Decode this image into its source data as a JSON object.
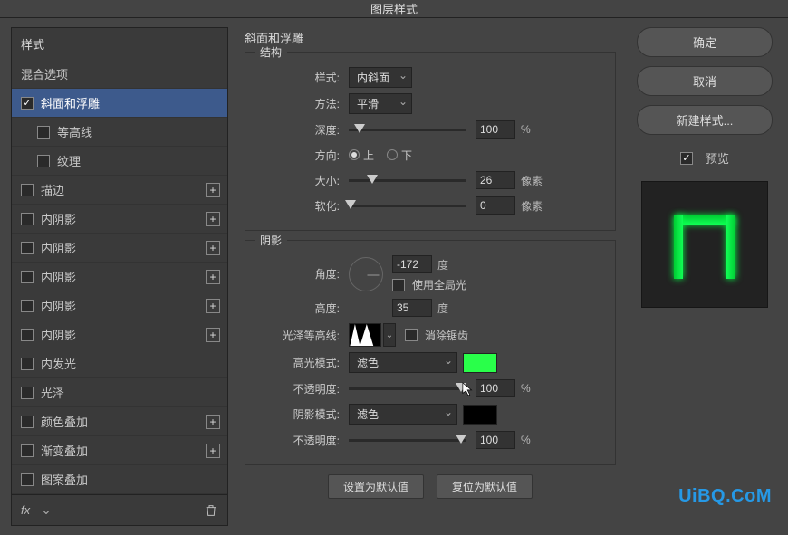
{
  "dialog": {
    "title": "图层样式"
  },
  "sidebar": {
    "header": "样式",
    "blend": "混合选项",
    "items": [
      {
        "label": "斜面和浮雕",
        "checked": true,
        "selected": true,
        "add": false,
        "sub": false
      },
      {
        "label": "等高线",
        "checked": false,
        "selected": false,
        "add": false,
        "sub": true
      },
      {
        "label": "纹理",
        "checked": false,
        "selected": false,
        "add": false,
        "sub": true
      },
      {
        "label": "描边",
        "checked": false,
        "selected": false,
        "add": true,
        "sub": false
      },
      {
        "label": "内阴影",
        "checked": false,
        "selected": false,
        "add": true,
        "sub": false
      },
      {
        "label": "内阴影",
        "checked": false,
        "selected": false,
        "add": true,
        "sub": false
      },
      {
        "label": "内阴影",
        "checked": false,
        "selected": false,
        "add": true,
        "sub": false
      },
      {
        "label": "内阴影",
        "checked": false,
        "selected": false,
        "add": true,
        "sub": false
      },
      {
        "label": "内阴影",
        "checked": false,
        "selected": false,
        "add": true,
        "sub": false
      },
      {
        "label": "内发光",
        "checked": false,
        "selected": false,
        "add": false,
        "sub": false
      },
      {
        "label": "光泽",
        "checked": false,
        "selected": false,
        "add": false,
        "sub": false
      },
      {
        "label": "颜色叠加",
        "checked": false,
        "selected": false,
        "add": true,
        "sub": false
      },
      {
        "label": "渐变叠加",
        "checked": false,
        "selected": false,
        "add": true,
        "sub": false
      },
      {
        "label": "图案叠加",
        "checked": false,
        "selected": false,
        "add": false,
        "sub": false
      }
    ],
    "fx": "fx"
  },
  "main": {
    "title": "斜面和浮雕",
    "structure": {
      "legend": "结构",
      "style_label": "样式:",
      "style_value": "内斜面",
      "technique_label": "方法:",
      "technique_value": "平滑",
      "depth_label": "深度:",
      "depth_value": "100",
      "depth_unit": "%",
      "direction_label": "方向:",
      "up": "上",
      "down": "下",
      "size_label": "大小:",
      "size_value": "26",
      "size_unit": "像素",
      "soften_label": "软化:",
      "soften_value": "0",
      "soften_unit": "像素"
    },
    "shading": {
      "legend": "阴影",
      "angle_label": "角度:",
      "angle_value": "-172",
      "angle_unit": "度",
      "global_light": "使用全局光",
      "altitude_label": "高度:",
      "altitude_value": "35",
      "altitude_unit": "度",
      "gloss_label": "光泽等高线:",
      "antialias": "消除锯齿",
      "highlight_mode_label": "高光模式:",
      "highlight_mode_value": "滤色",
      "highlight_color": "#29ff4a",
      "highlight_opacity_label": "不透明度:",
      "highlight_opacity_value": "100",
      "highlight_opacity_unit": "%",
      "shadow_mode_label": "阴影模式:",
      "shadow_mode_value": "滤色",
      "shadow_color": "#000000",
      "shadow_opacity_label": "不透明度:",
      "shadow_opacity_value": "100",
      "shadow_opacity_unit": "%"
    },
    "buttons": {
      "make_default": "设置为默认值",
      "reset_default": "复位为默认值"
    }
  },
  "right": {
    "ok": "确定",
    "cancel": "取消",
    "new_style": "新建样式...",
    "preview_label": "预览"
  },
  "watermark": "UiBQ.CoM"
}
